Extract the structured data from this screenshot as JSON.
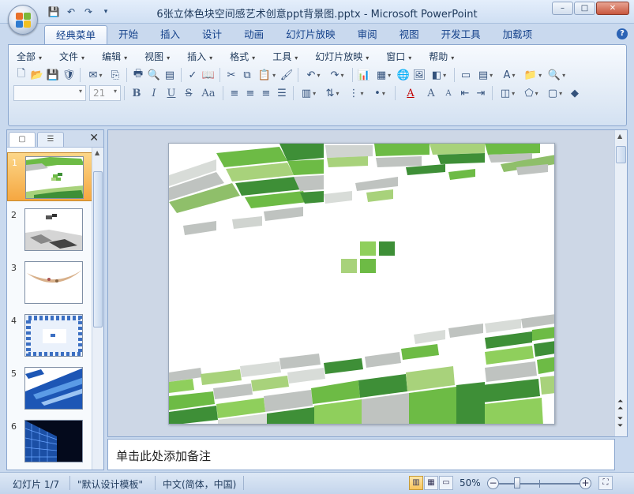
{
  "window": {
    "title": "6张立体色块空间感艺术创意ppt背景图.pptx - Microsoft PowerPoint",
    "min": "–",
    "max": "□",
    "close": "✕"
  },
  "qat": [
    "💾",
    "↶",
    "↷",
    "▾"
  ],
  "tabs": [
    "经典菜单",
    "开始",
    "插入",
    "设计",
    "动画",
    "幻灯片放映",
    "审阅",
    "视图",
    "开发工具",
    "加载项"
  ],
  "active_tab": "经典菜单",
  "help": "?",
  "classic_menu": [
    "全部",
    "文件",
    "编辑",
    "视图",
    "插入",
    "格式",
    "工具",
    "幻灯片放映",
    "窗口",
    "帮助"
  ],
  "toolbar": {
    "font_name": "",
    "font_size": "21",
    "bold": "B",
    "italic": "I",
    "underline": "U",
    "strike": "S",
    "case": "Aa",
    "font_color": "A",
    "grow": "A",
    "shrink": "A",
    "text_box": "A"
  },
  "pane_tabs": {
    "slides": "▢",
    "outline": "☰",
    "close": "✕"
  },
  "slides": [
    {
      "num": "1",
      "selected": true
    },
    {
      "num": "2",
      "selected": false
    },
    {
      "num": "3",
      "selected": false
    },
    {
      "num": "4",
      "selected": false
    },
    {
      "num": "5",
      "selected": false
    },
    {
      "num": "6",
      "selected": false
    }
  ],
  "notes_placeholder": "单击此处添加备注",
  "status": {
    "slide_info": "幻灯片 1/7",
    "theme": "\"默认设计模板\"",
    "language": "中文(简体，中国)",
    "zoom": "50%",
    "zoom_level": 0.5
  },
  "colors": {
    "green_dark": "#3e8f37",
    "green_mid": "#6dbb45",
    "green_light": "#a8d27b",
    "grey_block": "#bfc3c0",
    "selected_thumb": "#f5a741"
  }
}
